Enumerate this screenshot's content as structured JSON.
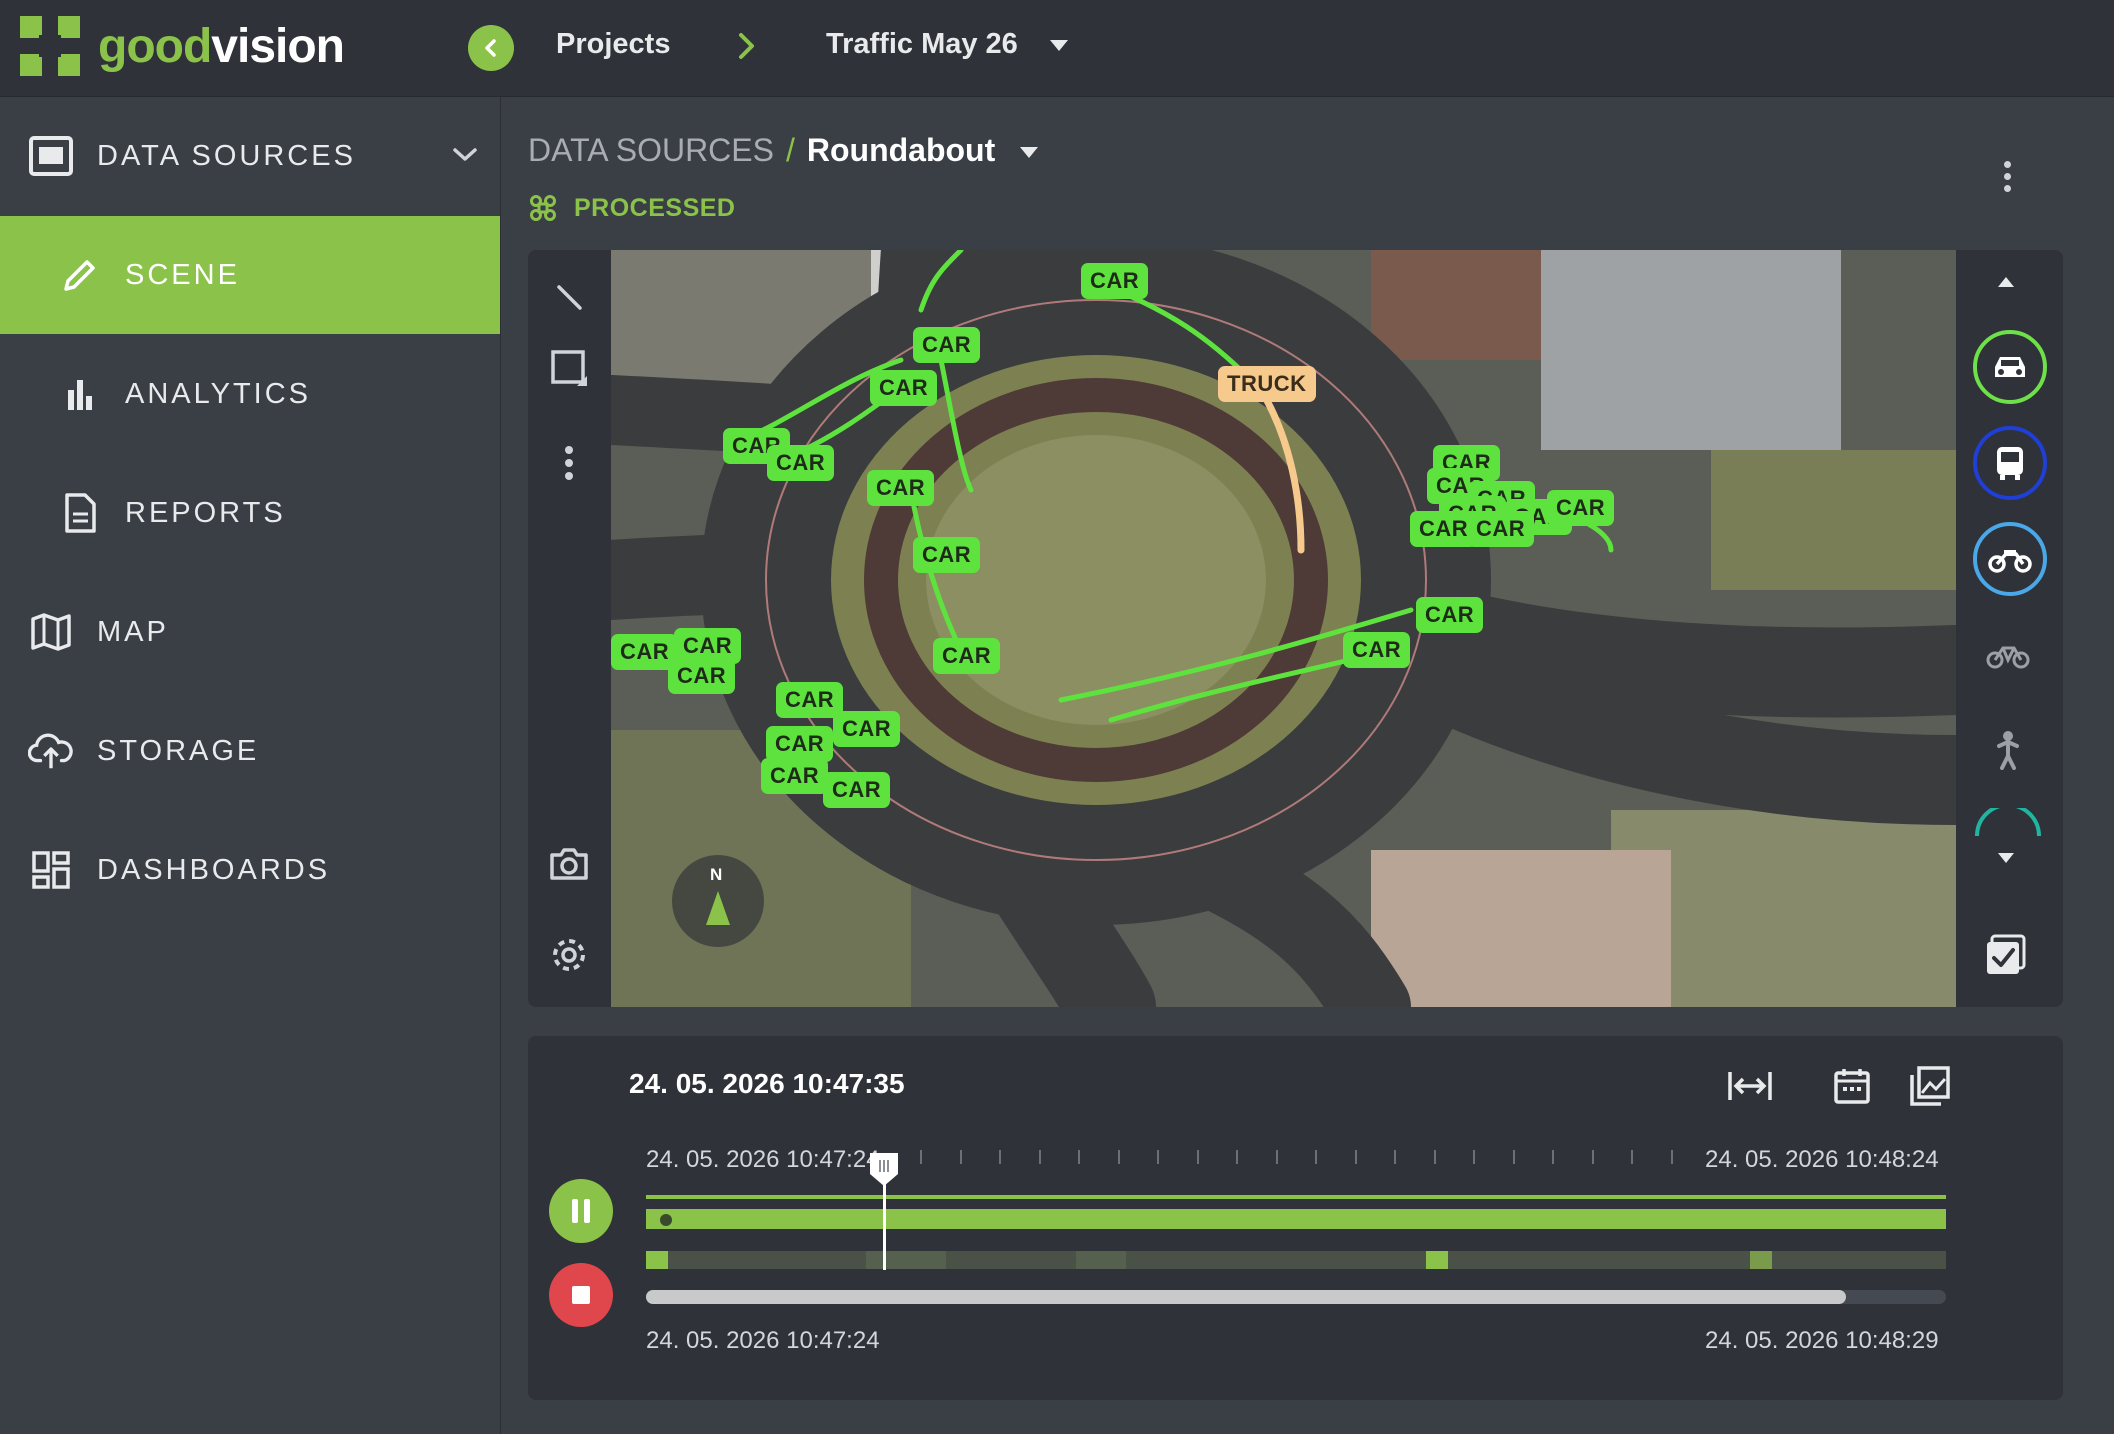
{
  "topbar": {
    "logo_good": "good",
    "logo_vision": "vision",
    "projects_label": "Projects",
    "project_name": "Traffic May 26"
  },
  "sidebar": {
    "items": [
      {
        "label": "DATA SOURCES",
        "icon": "monitor-icon"
      },
      {
        "label": "SCENE",
        "icon": "pencil-icon",
        "active": true
      },
      {
        "label": "ANALYTICS",
        "icon": "bar-chart-icon"
      },
      {
        "label": "REPORTS",
        "icon": "document-icon"
      },
      {
        "label": "MAP",
        "icon": "map-icon"
      },
      {
        "label": "STORAGE",
        "icon": "cloud-upload-icon"
      },
      {
        "label": "DASHBOARDS",
        "icon": "dashboard-icon"
      }
    ]
  },
  "breadcrumb": {
    "parent": "DATA SOURCES",
    "separator": "/",
    "current": "Roundabout"
  },
  "status": {
    "label": "PROCESSED",
    "color": "#8bc34a"
  },
  "scene": {
    "compass_label": "N",
    "detections": [
      {
        "label": "CAR",
        "class": "car"
      },
      {
        "label": "CAR",
        "class": "car"
      },
      {
        "label": "CAR",
        "class": "car"
      },
      {
        "label": "CAR",
        "class": "car"
      },
      {
        "label": "CAR",
        "class": "car"
      },
      {
        "label": "CAR",
        "class": "car"
      },
      {
        "label": "CAR",
        "class": "car"
      },
      {
        "label": "CAR",
        "class": "car"
      },
      {
        "label": "TRUCK",
        "class": "truck"
      },
      {
        "label": "CAR",
        "class": "car"
      },
      {
        "label": "CAR",
        "class": "car"
      },
      {
        "label": "CAR",
        "class": "car"
      },
      {
        "label": "CAR",
        "class": "car"
      },
      {
        "label": "CAR",
        "class": "car"
      },
      {
        "label": "CAR",
        "class": "car"
      },
      {
        "label": "CAR",
        "class": "car"
      },
      {
        "label": "CAR",
        "class": "car"
      },
      {
        "label": "CAR",
        "class": "car"
      },
      {
        "label": "CAR",
        "class": "car"
      },
      {
        "label": "CAR",
        "class": "car"
      },
      {
        "label": "CAR",
        "class": "car"
      },
      {
        "label": "CAR",
        "class": "car"
      },
      {
        "label": "CAR",
        "class": "car"
      },
      {
        "label": "CAR",
        "class": "car"
      },
      {
        "label": "CAR",
        "class": "car"
      },
      {
        "label": "CAR",
        "class": "car"
      },
      {
        "label": "CAR",
        "class": "car"
      }
    ],
    "class_filters": [
      {
        "name": "car-filter-icon",
        "color": "#6ee04a"
      },
      {
        "name": "bus-filter-icon",
        "color": "#1f3fd6"
      },
      {
        "name": "motorcycle-filter-icon",
        "color": "#4aa8e8"
      },
      {
        "name": "bicycle-filter-icon",
        "color": "#9aa0a6"
      },
      {
        "name": "pedestrian-filter-icon",
        "color": "#9aa0a6"
      }
    ]
  },
  "timeline": {
    "current_datetime": "24. 05. 2026 10:47:35",
    "window_start": "24. 05. 2026 10:47:24",
    "window_end": "24. 05. 2026 10:48:24",
    "range_start": "24. 05. 2026 10:47:24",
    "range_end": "24. 05. 2026 10:48:29",
    "playhead_fraction": 0.183,
    "progress_fraction": 0.923,
    "accent": "#8bc34a",
    "stop_color": "#e0474c"
  }
}
